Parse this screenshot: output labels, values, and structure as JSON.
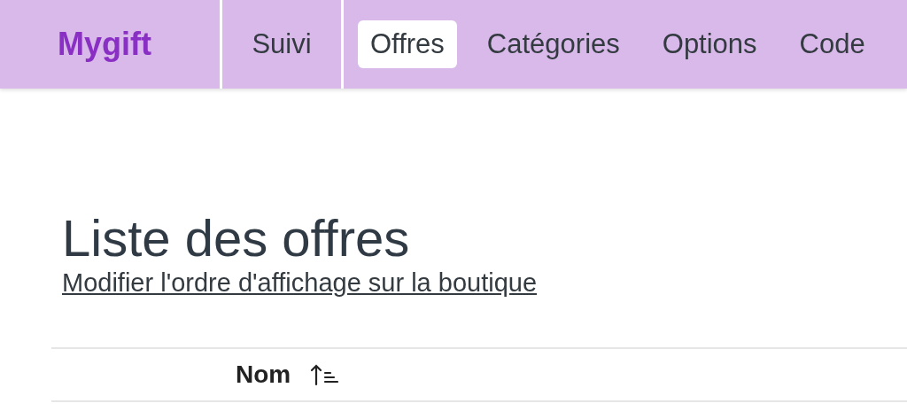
{
  "brand": "Mygift",
  "sections": [
    {
      "label": "Suivi",
      "selected": false
    }
  ],
  "tabs": [
    {
      "label": "Offres",
      "selected": true
    },
    {
      "label": "Catégories",
      "selected": false
    },
    {
      "label": "Options",
      "selected": false
    },
    {
      "label": "Code",
      "selected": false
    }
  ],
  "page": {
    "title": "Liste des offres",
    "link": "Modifier l'ordre d'affichage sur la boutique"
  },
  "table": {
    "columns": [
      {
        "label": "Nom",
        "sorted_ascending": true
      }
    ]
  }
}
